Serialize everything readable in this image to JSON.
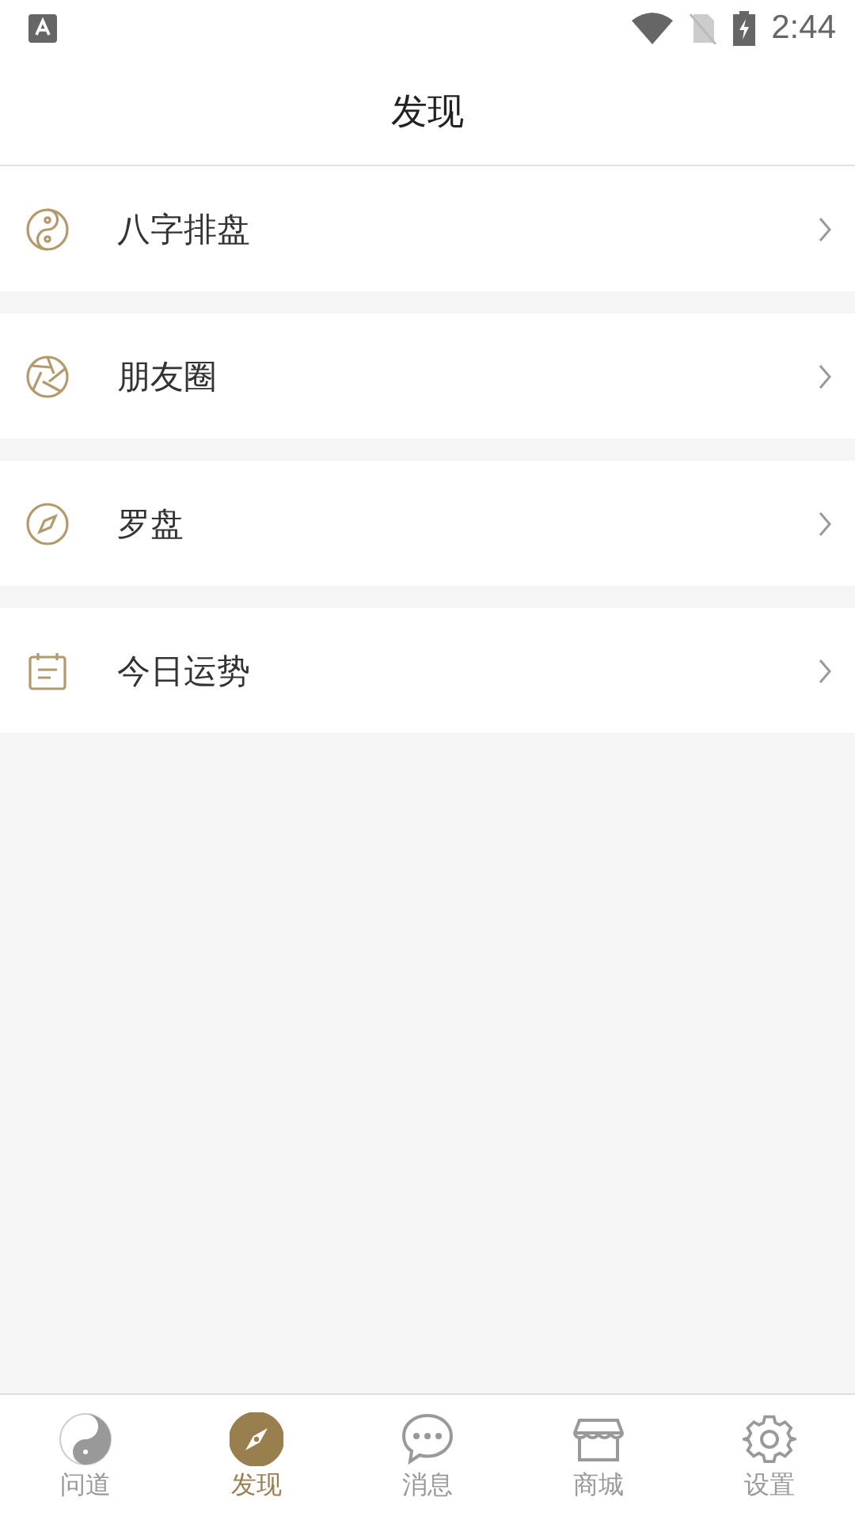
{
  "status_bar": {
    "time": "2:44"
  },
  "header": {
    "title": "发现"
  },
  "menu": [
    {
      "kind": "taiji",
      "label": "八字排盘"
    },
    {
      "kind": "aperture",
      "label": "朋友圈"
    },
    {
      "kind": "compass",
      "label": "罗盘"
    },
    {
      "kind": "calendar",
      "label": "今日运势"
    }
  ],
  "tabs": [
    {
      "kind": "taiji",
      "label": "问道",
      "selected": false
    },
    {
      "kind": "compass",
      "label": "发现",
      "selected": true
    },
    {
      "kind": "chat",
      "label": "消息",
      "selected": false
    },
    {
      "kind": "store",
      "label": "商城",
      "selected": false
    },
    {
      "kind": "gear",
      "label": "设置",
      "selected": false
    }
  ]
}
